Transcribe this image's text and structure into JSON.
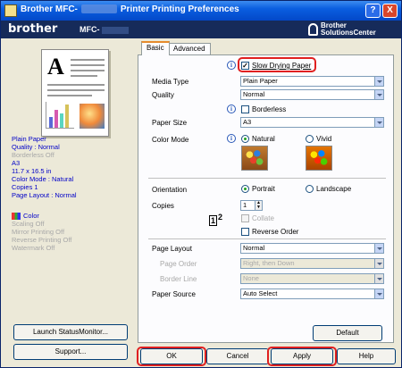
{
  "window": {
    "title_prefix": "Brother MFC-",
    "title_suffix": "Printer Printing Preferences",
    "help_btn": "?",
    "close_btn": "X"
  },
  "banner": {
    "brand": "brother",
    "model": "MFC-",
    "solutions_line1": "Brother",
    "solutions_line2": "SolutionsCenter"
  },
  "summary": {
    "lines": [
      "Plain Paper",
      "Quality : Normal",
      "Borderless Off",
      "A3",
      "11.7 x 16.5 in",
      "Color Mode : Natural",
      "Copies 1",
      "Page Layout : Normal"
    ],
    "color": "Color",
    "gray_lines": [
      "Scaling Off",
      "Mirror Printing Off",
      "Reverse Printing Off",
      "Watermark Off"
    ]
  },
  "left_buttons": {
    "launch": "Launch StatusMonitor...",
    "support": "Support..."
  },
  "tabs": [
    "Basic",
    "Advanced"
  ],
  "basic": {
    "slow_drying": "Slow Drying Paper",
    "media_type_label": "Media Type",
    "media_type_value": "Plain Paper",
    "quality_label": "Quality",
    "quality_value": "Normal",
    "borderless": "Borderless",
    "paper_size_label": "Paper Size",
    "paper_size_value": "A3",
    "color_mode_label": "Color Mode",
    "natural": "Natural",
    "vivid": "Vivid",
    "orientation_label": "Orientation",
    "portrait": "Portrait",
    "landscape": "Landscape",
    "copies_label": "Copies",
    "copies_value": "1",
    "collate": "Collate",
    "reverse_order": "Reverse Order",
    "page_layout_label": "Page Layout",
    "page_layout_value": "Normal",
    "page_order_label": "Page Order",
    "page_order_value": "Right, then Down",
    "border_line_label": "Border Line",
    "border_line_value": "None",
    "paper_source_label": "Paper Source",
    "paper_source_value": "Auto Select",
    "default_btn": "Default"
  },
  "footer": {
    "ok": "OK",
    "cancel": "Cancel",
    "apply": "Apply",
    "help": "Help"
  },
  "state": {
    "slow_drying_checked": true,
    "borderless_checked": false,
    "color_mode": "Natural",
    "orientation": "Portrait",
    "collate_checked": false,
    "reverse_order_checked": false
  },
  "colors": {
    "title_bar": "#0a5ee0",
    "banner": "#162b5a",
    "highlight": "#e02020",
    "summary_text": "#0000c8"
  }
}
